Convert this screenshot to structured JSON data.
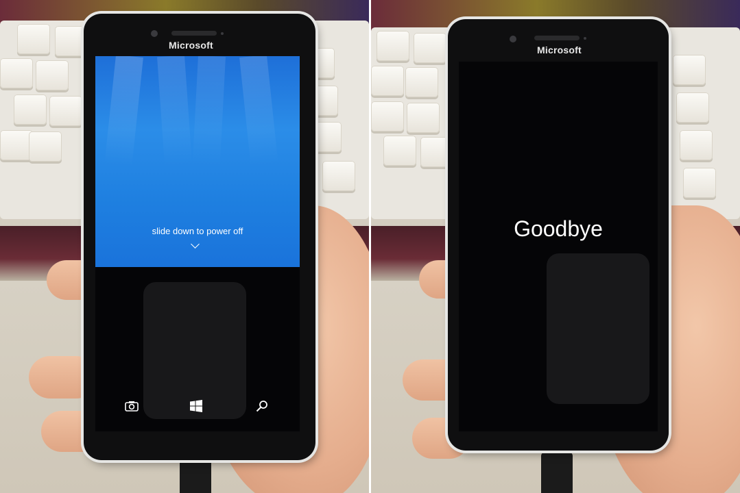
{
  "left_photo": {
    "brand_text": "Microsoft",
    "lock_screen_text": "slide down to power off",
    "nav_icons": [
      "camera-icon",
      "windows-logo-icon",
      "search-icon"
    ],
    "lock_color": "#1e7fe0"
  },
  "right_photo": {
    "brand_text": "Microsoft",
    "goodbye_text": "Goodbye"
  },
  "colors": {
    "phone_body": "#0f0f10",
    "text": "#ffffff"
  }
}
